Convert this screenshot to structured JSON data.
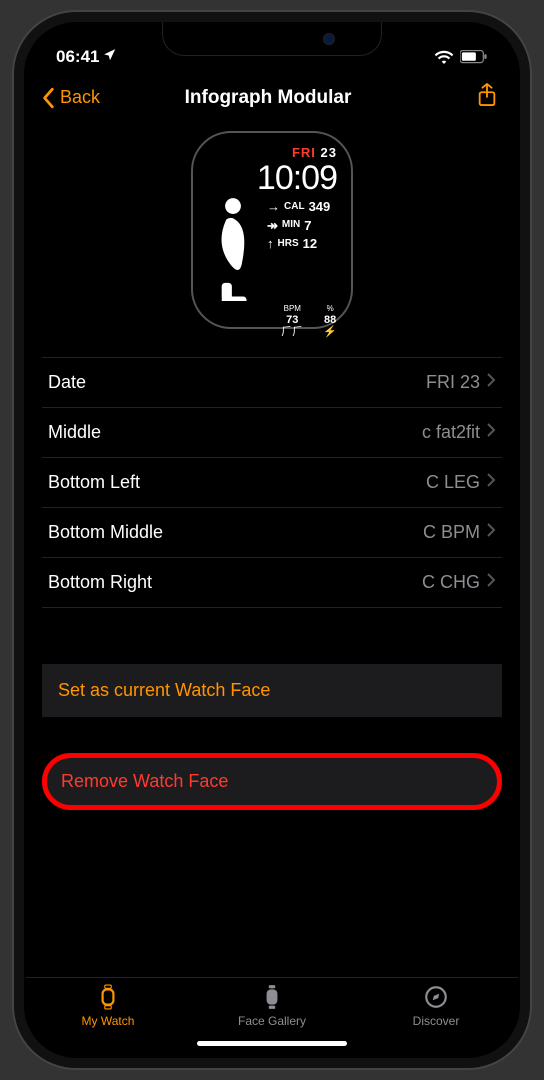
{
  "status": {
    "time": "06:41"
  },
  "nav": {
    "back": "Back",
    "title": "Infograph Modular"
  },
  "preview": {
    "day": "FRI",
    "date": "23",
    "time": "10:09",
    "cal_label": "CAL",
    "cal": "349",
    "min_label": "MIN",
    "min": "7",
    "hrs_label": "HRS",
    "hrs": "12",
    "bpm_label": "BPM",
    "bpm": "73",
    "chg_label": "%",
    "chg": "88"
  },
  "rows": {
    "date": {
      "label": "Date",
      "value": "FRI 23"
    },
    "middle": {
      "label": "Middle",
      "value": "c fat2fit"
    },
    "bl": {
      "label": "Bottom Left",
      "value": "C LEG"
    },
    "bm": {
      "label": "Bottom Middle",
      "value": "C BPM"
    },
    "br": {
      "label": "Bottom Right",
      "value": "C CHG"
    }
  },
  "actions": {
    "set_current": "Set as current Watch Face",
    "remove": "Remove Watch Face"
  },
  "tabs": {
    "my_watch": "My Watch",
    "face_gallery": "Face Gallery",
    "discover": "Discover"
  }
}
